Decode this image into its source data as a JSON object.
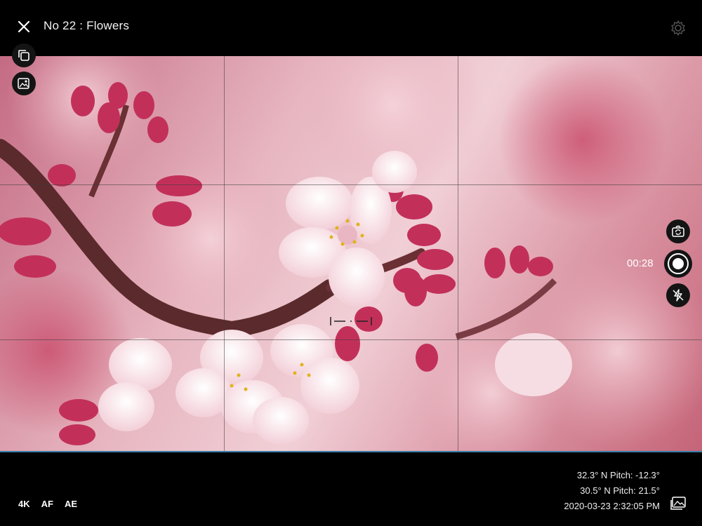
{
  "header": {
    "title": "No 22 : Flowers",
    "close_icon": "close-icon",
    "settings_icon": "gear-icon"
  },
  "viewfinder": {
    "grid": "3x3",
    "focus_reticle": "focus-bracket-icon"
  },
  "controls": {
    "timer": "00:28",
    "icons": [
      "copy-icon",
      "image-overlay-icon",
      "flip-camera-icon",
      "record-icon",
      "flash-off-icon",
      "gallery-icon"
    ]
  },
  "footer": {
    "modes": [
      "4K",
      "AF",
      "AE"
    ],
    "info_lines": [
      "32.3° N Pitch: -12.3°",
      "30.5° N Pitch: 21.5°",
      "2020-03-23 2:32:05 PM"
    ]
  },
  "colors": {
    "accent_line": "#3a7ea8",
    "background": "#000000"
  }
}
